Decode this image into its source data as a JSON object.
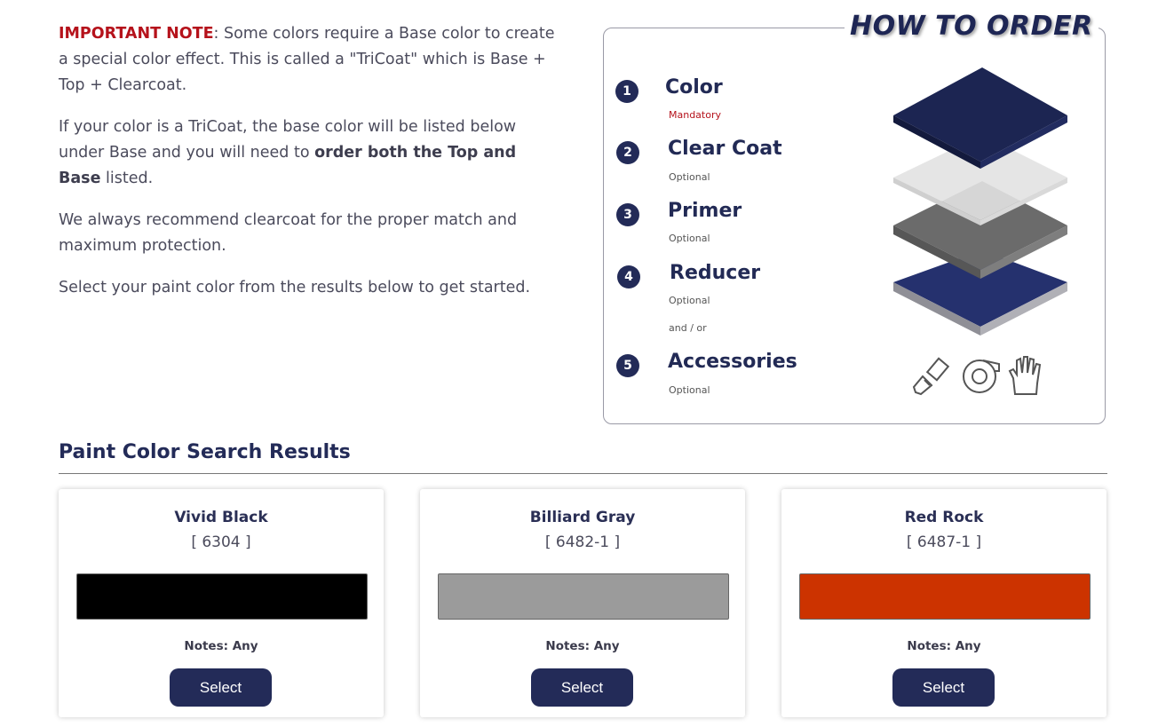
{
  "intro": {
    "important_label": "IMPORTANT NOTE",
    "important_text": ": Some colors require a Base color to create a special color effect. This is called a \"TriCoat\" which is Base + Top + Clearcoat.",
    "tricoat_text_pre": "If your color is a TriCoat, the base color will be listed below under Base and you will need to ",
    "tricoat_text_bold": "order both the Top and Base",
    "tricoat_text_post": " listed.",
    "recommend_text": "We always recommend clearcoat for the proper match and maximum protection.",
    "select_text": "Select your paint color from the results below to get started."
  },
  "how_to_order": {
    "title": "HOW TO ORDER",
    "steps": [
      {
        "num": "1",
        "label": "Color",
        "sub": "Mandatory"
      },
      {
        "num": "2",
        "label": "Clear Coat",
        "sub": "Optional"
      },
      {
        "num": "3",
        "label": "Primer",
        "sub": "Optional"
      },
      {
        "num": "4",
        "label": "Reducer",
        "sub": "Optional",
        "extra": "and / or"
      },
      {
        "num": "5",
        "label": "Accessories",
        "sub": "Optional"
      }
    ],
    "layer_colors": {
      "top": "#1c2552",
      "clear": "#e6e6e6",
      "primer": "#6b6b6b",
      "base": "#25316e",
      "edge": "#9a9aa0"
    },
    "tool_icons": [
      "paintbrush-icon",
      "masking-tape-icon",
      "glove-icon"
    ]
  },
  "results": {
    "title": "Paint Color Search Results",
    "cards": [
      {
        "name": "Vivid Black",
        "code": "[ 6304 ]",
        "color": "#000000",
        "notes": "Notes: Any",
        "button": "Select"
      },
      {
        "name": "Billiard Gray",
        "code": "[ 6482-1 ]",
        "color": "#9b9b9b",
        "notes": "Notes: Any",
        "button": "Select"
      },
      {
        "name": "Red Rock",
        "code": "[ 6487-1 ]",
        "color": "#cc3300",
        "notes": "Notes: Any",
        "button": "Select"
      }
    ]
  }
}
